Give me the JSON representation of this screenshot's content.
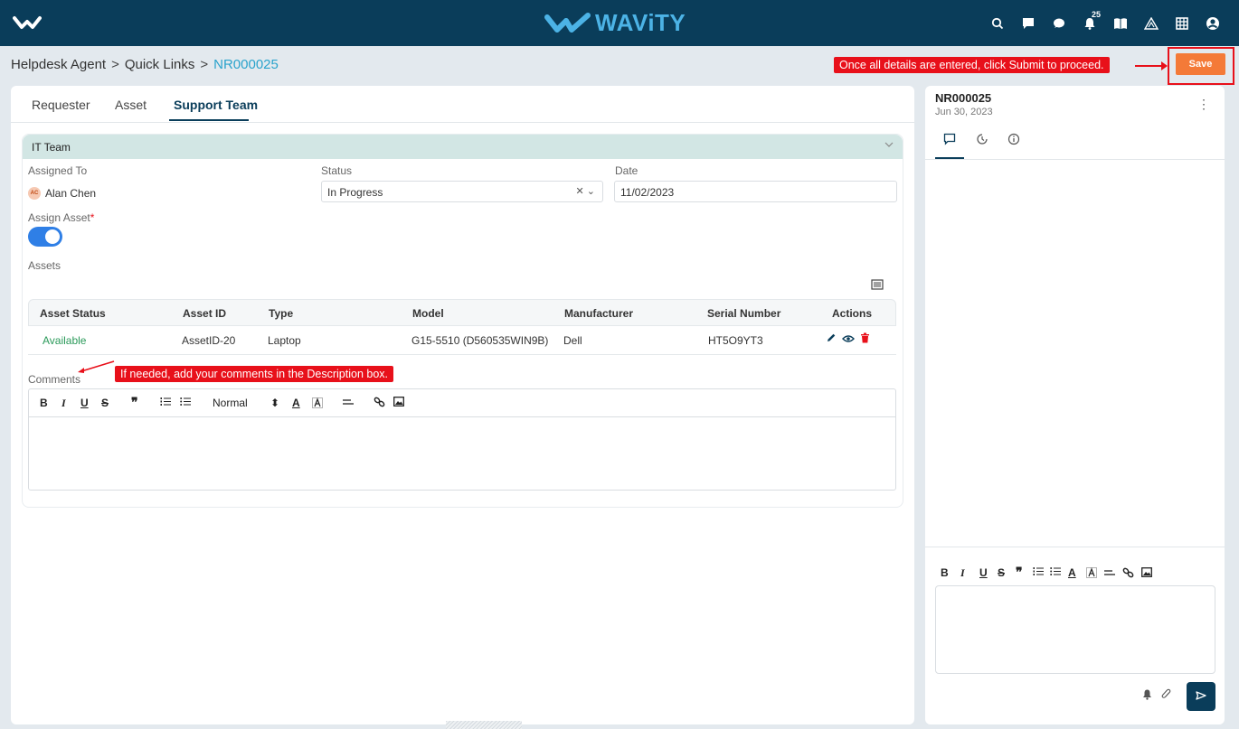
{
  "topbar": {
    "brand": "WAViTY",
    "notification_count": "25",
    "icons": [
      "search-icon",
      "chat-square-icon",
      "chat-bubble-icon",
      "bell-icon",
      "book-icon",
      "warning-icon",
      "grid-icon",
      "user-circle-icon"
    ]
  },
  "breadcrumb": {
    "items": [
      "Helpdesk Agent",
      "Quick Links",
      "NR000025"
    ],
    "separator": ">"
  },
  "hints": {
    "save": "Once all details are entered, click Submit to proceed.",
    "comments": "If needed, add your comments in the Description box."
  },
  "save_label": "Save",
  "tabs": [
    "Requester",
    "Asset",
    "Support Team"
  ],
  "active_tab": "Support Team",
  "section": {
    "title": "IT Team",
    "assigned_to_label": "Assigned To",
    "assignee_initials": "AC",
    "assignee_name": "Alan Chen",
    "status_label": "Status",
    "status_value": "In Progress",
    "date_label": "Date",
    "date_value": "11/02/2023",
    "assign_asset_label": "Assign Asset",
    "assign_asset_required": "*",
    "assign_asset_on": true,
    "assets_label": "Assets",
    "comments_label": "Comments"
  },
  "assets_table": {
    "columns": [
      "Asset Status",
      "Asset ID",
      "Type",
      "Model",
      "Manufacturer",
      "Serial Number",
      "Actions"
    ],
    "rows": [
      {
        "status": "Available",
        "asset_id": "AssetID-20",
        "type": "Laptop",
        "model": "G15-5510 (D560535WIN9B)",
        "manufacturer": "Dell",
        "serial": "HT5O9YT3"
      }
    ]
  },
  "editor": {
    "format_value": "Normal"
  },
  "side_panel": {
    "title": "NR000025",
    "date": "Jun 30, 2023"
  },
  "colors": {
    "topbar": "#0a3d5a",
    "brand": "#4cb3e6",
    "save_button": "#f47a38",
    "hint": "#e8101a",
    "section_header": "#d2e6e4",
    "toggle": "#2f7fe6",
    "available": "#2b9a5a"
  }
}
